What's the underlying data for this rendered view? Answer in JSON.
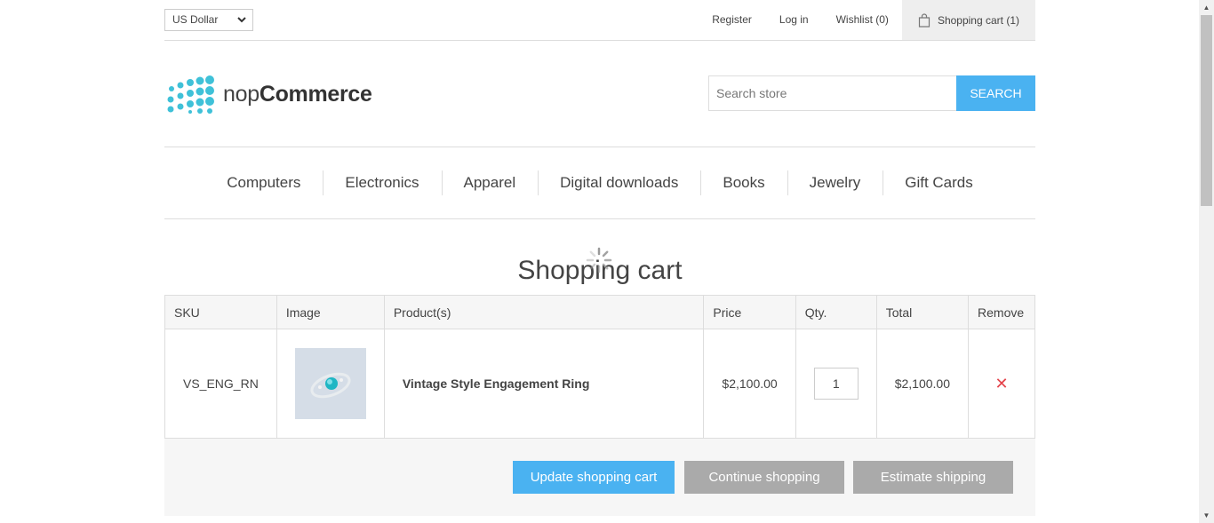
{
  "header": {
    "currency": "US Dollar",
    "links": {
      "register": "Register",
      "login": "Log in",
      "wishlist": "Wishlist (0)",
      "cart": "Shopping cart (1)"
    },
    "logo": {
      "prefix": "nop",
      "main": "Commerce"
    },
    "search": {
      "placeholder": "Search store",
      "button": "Search"
    }
  },
  "menu": [
    "Computers",
    "Electronics",
    "Apparel",
    "Digital downloads",
    "Books",
    "Jewelry",
    "Gift Cards"
  ],
  "page_title": "Shopping cart",
  "table": {
    "headers": {
      "sku": "SKU",
      "image": "Image",
      "product": "Product(s)",
      "price": "Price",
      "qty": "Qty.",
      "total": "Total",
      "remove": "Remove"
    },
    "rows": [
      {
        "sku": "VS_ENG_RN",
        "product": "Vintage Style Engagement Ring",
        "price": "$2,100.00",
        "qty": "1",
        "total": "$2,100.00",
        "remove": "✕"
      }
    ]
  },
  "buttons": {
    "update": "Update shopping cart",
    "continue": "Continue shopping",
    "estimate": "Estimate shipping"
  },
  "colors": {
    "accent": "#4ab2f1",
    "remove": "#e4434b",
    "grey_button": "#aaaaaa"
  }
}
